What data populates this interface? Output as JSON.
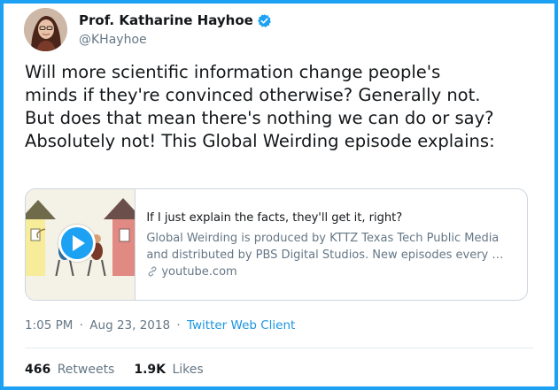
{
  "author": {
    "display_name": "Prof. Katharine Hayhoe",
    "handle": "@KHayhoe",
    "verified_icon": "verified-badge-icon"
  },
  "tweet": {
    "lines": [
      "Will more scientific information change people's",
      "minds if they're convinced otherwise? Generally not.",
      "But does that mean there's nothing we can do or say?",
      "Absolutely not! This Global Weirding episode explains:"
    ]
  },
  "card": {
    "title": "If I just explain the facts, they'll get it, right?",
    "description_lines": [
      "Global Weirding is produced by KTTZ Texas Tech Public Media",
      "and distributed by PBS Digital Studios. New episodes every …"
    ],
    "domain": "youtube.com",
    "play_icon": "play-icon"
  },
  "meta": {
    "time": "1:05 PM",
    "date": "Aug 23, 2018",
    "separator": "·",
    "source": "Twitter Web Client"
  },
  "stats": {
    "retweets_count": "466",
    "retweets_label": "Retweets",
    "likes_count": "1.9K",
    "likes_label": "Likes"
  },
  "colors": {
    "accent": "#1da1f2",
    "link": "#1b95e0",
    "secondary_text": "#657786"
  }
}
